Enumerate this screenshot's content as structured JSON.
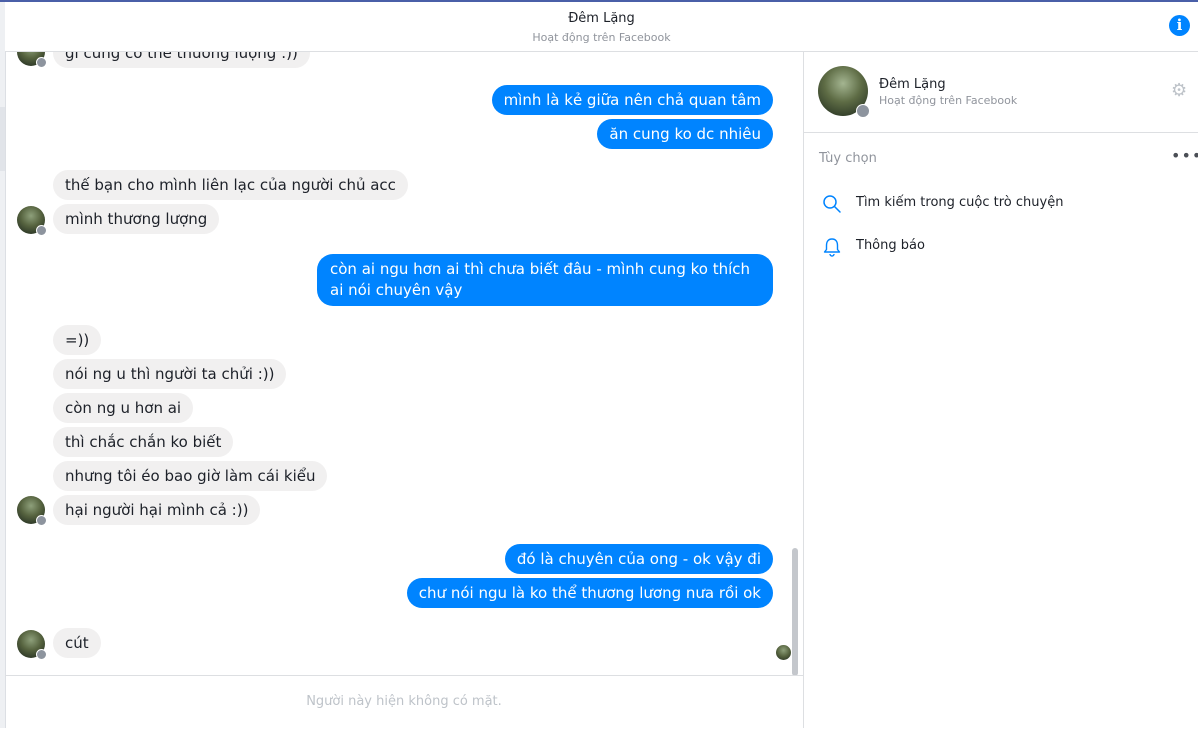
{
  "header": {
    "title": "Đêm Lặng",
    "subtitle": "Hoạt động trên Facebook"
  },
  "colors": {
    "accent": "#0084ff",
    "incoming_bubble": "#f1f0f0",
    "outgoing_text": "#ffffff"
  },
  "messages": [
    {
      "side": "in",
      "text": "gì cũng có thể thương lượng :))"
    },
    {
      "side": "out",
      "text": "mình là kẻ giữa nên chả quan tâm"
    },
    {
      "side": "out",
      "text": "ăn cung ko dc nhiêu"
    },
    {
      "side": "in",
      "text": "thế bạn cho mình liên lạc của người chủ acc"
    },
    {
      "side": "in",
      "text": "mình thương lượng"
    },
    {
      "side": "out",
      "text": "còn ai ngu hơn ai thì chưa biết đâu - mình cung ko thích ai nói chuyên vậy"
    },
    {
      "side": "in",
      "text": "=))"
    },
    {
      "side": "in",
      "text": "nói ng u thì người ta chửi :))"
    },
    {
      "side": "in",
      "text": "còn ng u hơn ai"
    },
    {
      "side": "in",
      "text": "thì chắc chắn ko biết"
    },
    {
      "side": "in",
      "text": "nhưng tôi éo bao giờ làm cái kiểu"
    },
    {
      "side": "in",
      "text": "hại người hại mình cả :))"
    },
    {
      "side": "out",
      "text": "đó là chuyên của ong - ok vậy đi"
    },
    {
      "side": "out",
      "text": "chư nói ngu là ko thể thương lương nưa rồi ok"
    },
    {
      "side": "in",
      "text": "cút"
    }
  ],
  "footer": {
    "status_text": "Người này hiện không có mặt."
  },
  "sidebar": {
    "profile_name": "Đêm Lặng",
    "profile_status": "Hoạt động trên Facebook",
    "options_title": "Tùy chọn",
    "options": [
      {
        "icon": "search-icon",
        "label": "Tìm kiếm trong cuộc trò chuyện"
      },
      {
        "icon": "bell-icon",
        "label": "Thông báo"
      }
    ]
  }
}
